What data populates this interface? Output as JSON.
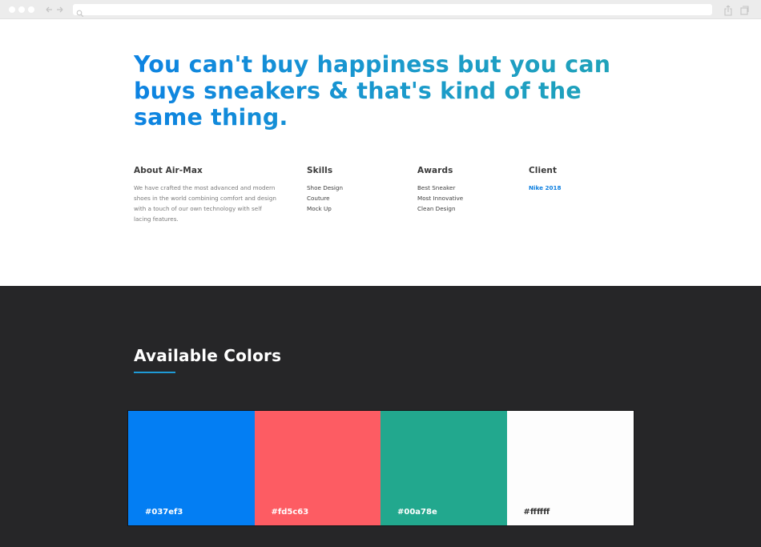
{
  "hero": {
    "line1": "You can't buy happiness but you can",
    "line2": "buys sneakers & that's kind of the",
    "line3": "same thing."
  },
  "about": {
    "heading": "About Air-Max",
    "lines": [
      "We have crafted the most advanced and modern",
      "shoes in the world combining  comfort and design",
      "with a touch of our own technology with self",
      "lacing features."
    ]
  },
  "skills": {
    "heading": "Skills",
    "items": [
      "Shoe Design",
      "Couture",
      "Mock Up"
    ]
  },
  "awards": {
    "heading": "Awards",
    "items": [
      "Best Sneaker",
      "Most Innovative",
      "Clean Design"
    ]
  },
  "client": {
    "heading": "Client",
    "items": [
      "Nike 2018"
    ]
  },
  "colors_section": {
    "title": "Available Colors",
    "underline_color": "#1f9ad6",
    "background": "#262628",
    "swatches": [
      {
        "label": "#037ef3",
        "color": "#037ef3",
        "text_color": "#ffffff"
      },
      {
        "label": "#fd5c63",
        "color": "#fd5c63",
        "text_color": "#ffffff"
      },
      {
        "label": "#00a78e",
        "color": "#22a88e",
        "text_color": "#ffffff"
      },
      {
        "label": "#ffffff",
        "color": "#fdfdfd",
        "text_color": "#333333"
      }
    ]
  },
  "icons": {
    "nav": "back-forward-arrows-icon",
    "search": "search-icon",
    "share": "share-icon",
    "tabs": "tabs-icon"
  }
}
